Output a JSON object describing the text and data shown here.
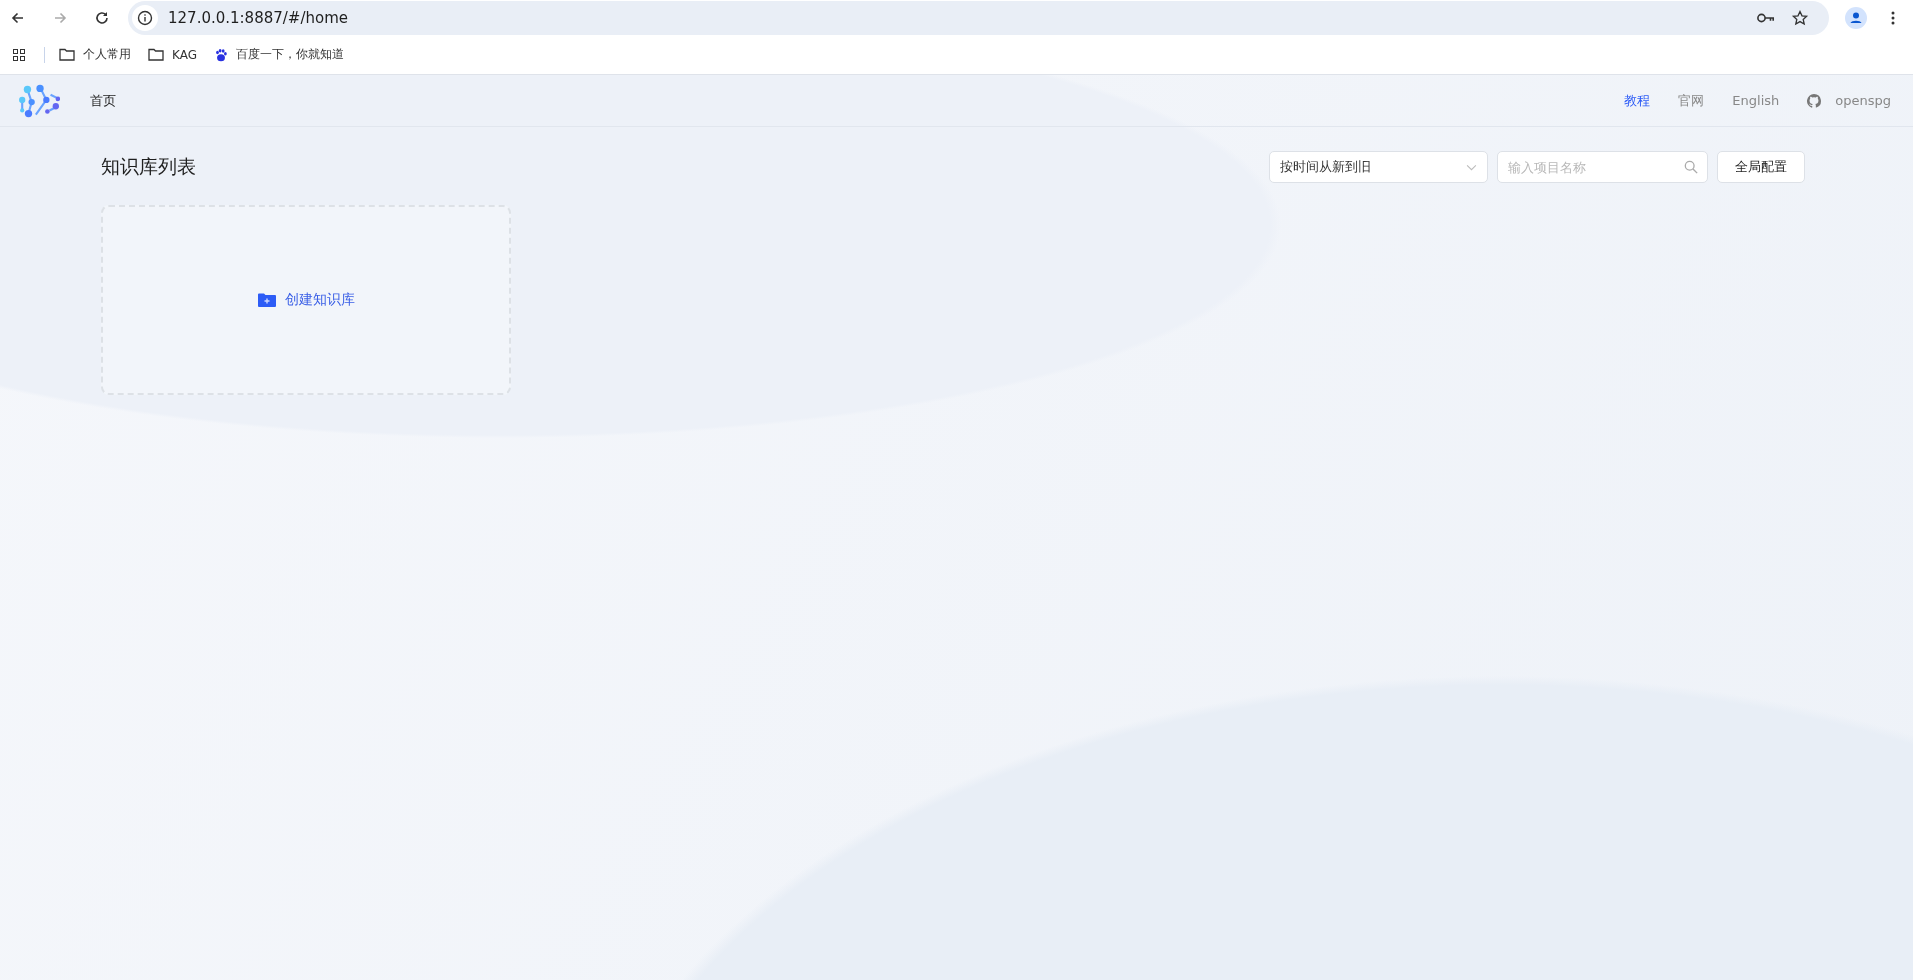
{
  "browser": {
    "url": "127.0.0.1:8887/#/home",
    "bookmarks": [
      {
        "kind": "folder",
        "label": "个人常用"
      },
      {
        "kind": "folder",
        "label": "KAG"
      },
      {
        "kind": "site",
        "label": "百度一下，你就知道"
      }
    ]
  },
  "header": {
    "nav": [
      {
        "label": "首页"
      }
    ],
    "links": [
      {
        "kind": "text",
        "label": "教程",
        "selected": true
      },
      {
        "kind": "text",
        "label": "官网",
        "selected": false
      },
      {
        "kind": "text",
        "label": "English",
        "selected": false
      },
      {
        "kind": "github",
        "label": "openspg",
        "selected": false
      }
    ]
  },
  "page": {
    "title": "知识库列表",
    "sort_select": {
      "value": "按时间从新到旧"
    },
    "search": {
      "placeholder": "输入项目名称"
    },
    "config_button": "全局配置",
    "create_card": {
      "label": "创建知识库"
    }
  }
}
